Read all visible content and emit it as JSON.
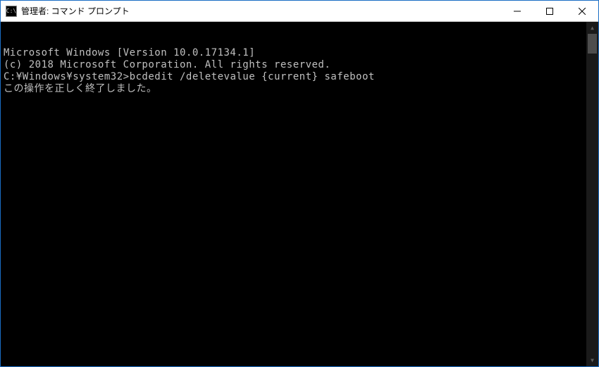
{
  "window": {
    "icon_text": "C:\\",
    "title": "管理者: コマンド プロンプト"
  },
  "terminal": {
    "line1": "Microsoft Windows [Version 10.0.17134.1]",
    "line2": "(c) 2018 Microsoft Corporation. All rights reserved.",
    "blank1": "",
    "prompt": "C:¥Windows¥system32>",
    "command": "bcdedit /deletevalue {current} safeboot",
    "result": "この操作を正しく終了しました。"
  }
}
